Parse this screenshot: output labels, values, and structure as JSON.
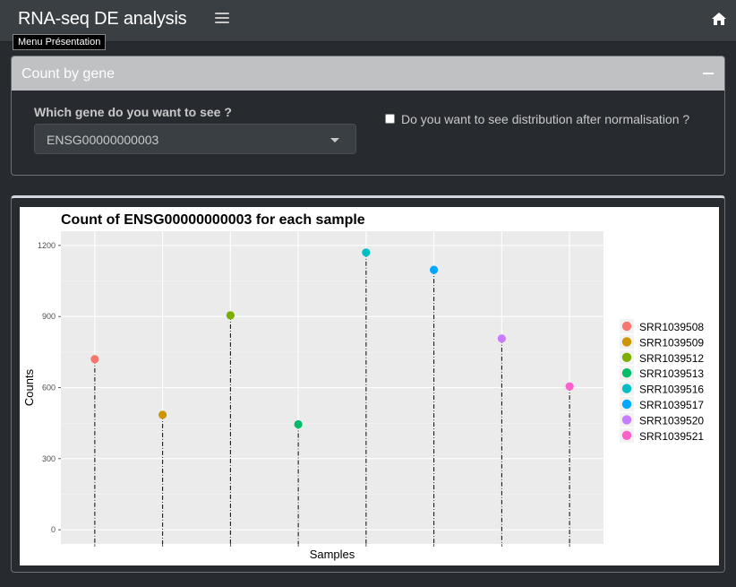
{
  "header": {
    "app_title": "RNA-seq DE analysis",
    "menu_icon": "hamburger-menu-icon",
    "home_icon": "home-icon",
    "tooltip": "Menu Présentation"
  },
  "count_box": {
    "title": "Count by gene",
    "collapse_icon": "minus-icon",
    "gene_question": "Which gene do you want to see ?",
    "gene_selected": "ENSG00000000003",
    "normalise_label": "Do you want to see distribution after normalisation ?",
    "normalise_checked": false
  },
  "chart_data": {
    "type": "scatter",
    "title": "Count of ENSG00000000003 for each sample",
    "xlabel": "Samples",
    "ylabel": "Counts",
    "categories": [
      "SRR1039508",
      "SRR1039509",
      "SRR1039512",
      "SRR1039513",
      "SRR1039516",
      "SRR1039517",
      "SRR1039520",
      "SRR1039521"
    ],
    "values": [
      720,
      485,
      905,
      445,
      1170,
      1097,
      807,
      605
    ],
    "yticks": [
      0,
      300,
      600,
      900,
      1200
    ],
    "ylim": [
      -60,
      1260
    ],
    "grid": true,
    "legend_position": "right",
    "series_colors": [
      "#F8766D",
      "#CD9600",
      "#7CAE00",
      "#00BE67",
      "#00BFC4",
      "#00A9FF",
      "#C77CFF",
      "#FF61CC"
    ]
  }
}
